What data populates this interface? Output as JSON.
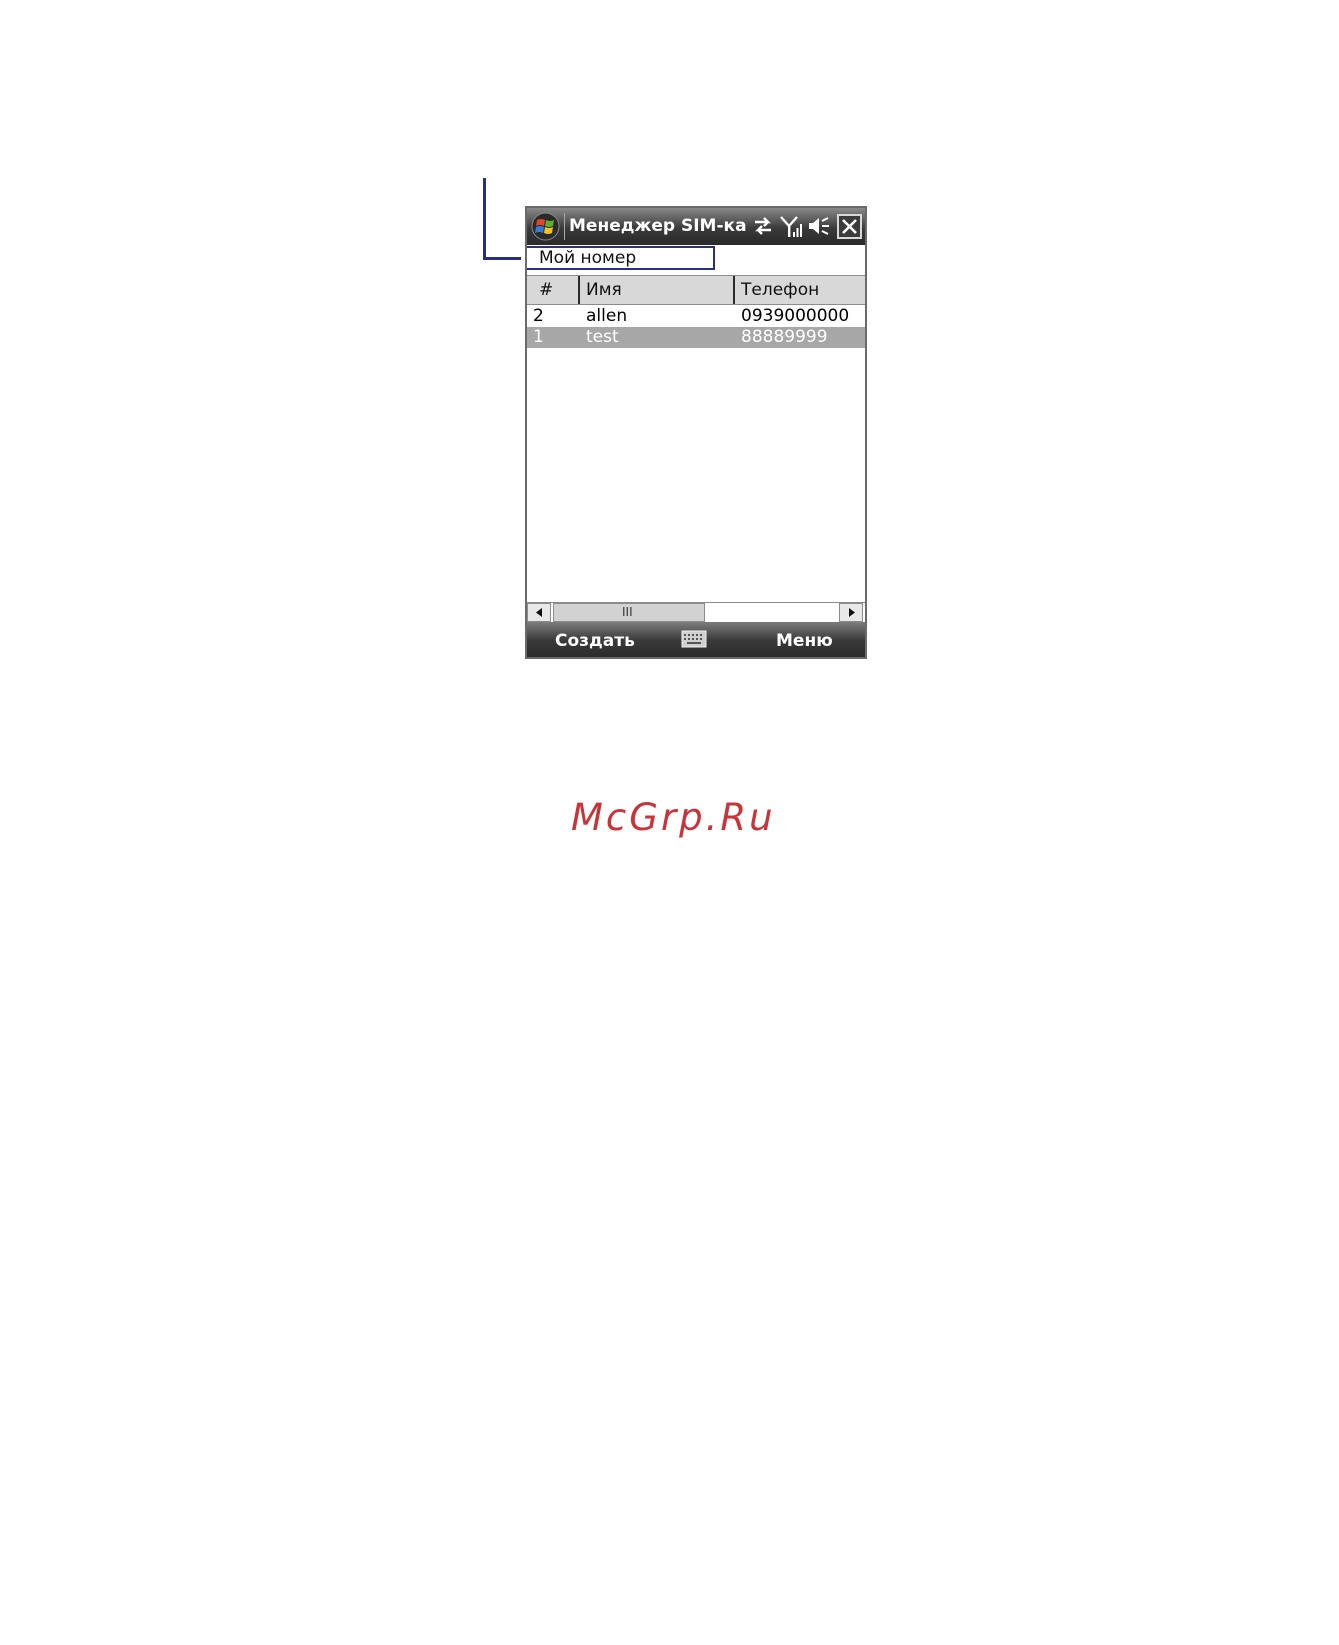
{
  "app": {
    "title": "Менеджер SIM-кар",
    "icons": [
      "windows-start-icon",
      "sync-arrows-icon",
      "signal-icon",
      "speaker-mute-icon",
      "close-icon"
    ]
  },
  "my_number": {
    "label": "Мой номер"
  },
  "table": {
    "columns": [
      "#",
      "Имя",
      "Телефон"
    ],
    "rows": [
      {
        "num": "2",
        "name": "allen",
        "phone": "0939000000",
        "selected": false
      },
      {
        "num": "1",
        "name": "test",
        "phone": "88889999",
        "selected": true
      }
    ]
  },
  "scrollbar": {
    "thumb_glyph": "III"
  },
  "softkeys": {
    "left": "Создать",
    "right": "Меню",
    "center_icon": "keyboard-icon"
  },
  "watermark": {
    "text": "McGrp.Ru"
  },
  "colors": {
    "callout": "#2b2e7a",
    "selected_row": "#a7a7a7",
    "watermark": "#c8343a"
  }
}
